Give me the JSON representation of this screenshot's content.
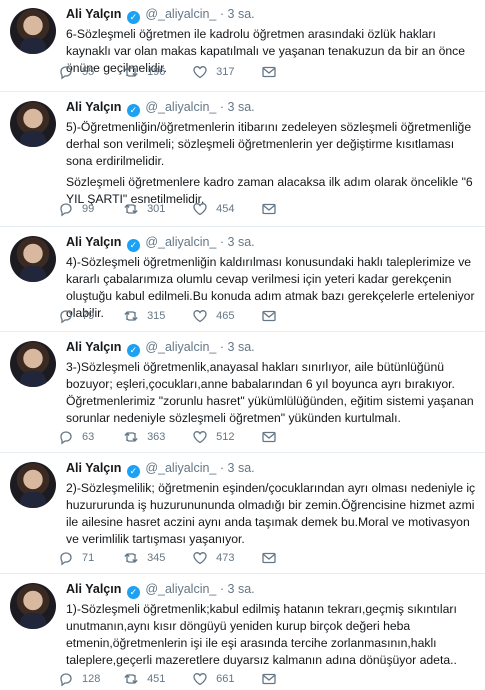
{
  "tweets": [
    {
      "name": "Ali Yalçın",
      "handle": "@_aliyalcin_",
      "dot": "·",
      "time": "3 sa.",
      "paragraphs": [
        "6-Sözleşmeli öğretmen ile kadrolu öğretmen arasındaki özlük hakları kaynaklı var olan makas kapatılmalı ve yaşanan tenakuzun da bir an önce önüne geçilmelidir."
      ],
      "replies": "55",
      "retweets": "196",
      "likes": "317"
    },
    {
      "name": "Ali Yalçın",
      "handle": "@_aliyalcin_",
      "dot": "·",
      "time": "3 sa.",
      "paragraphs": [
        "5)-Öğretmenliğin/öğretmenlerin itibarını zedeleyen sözleşmeli öğretmenliğe derhal son verilmeli; sözleşmeli öğretmenlerin yer değiştirme kısıtlaması sona erdirilmelidir.",
        "Sözleşmeli öğretmenlere kadro zaman alacaksa ilk adım olarak öncelikle \"6 YIL ŞARTI\" esnetilmelidir."
      ],
      "replies": "99",
      "retweets": "301",
      "likes": "454"
    },
    {
      "name": "Ali Yalçın",
      "handle": "@_aliyalcin_",
      "dot": "·",
      "time": "3 sa.",
      "paragraphs": [
        "4)-Sözleşmeli öğretmenliğin kaldırılması konusundaki haklı taleplerimize ve kararlı çabalarımıza olumlu cevap verilmesi için yeteri kadar gerekçenin oluştuğu kabul edilmeli.Bu konuda adım atmak bazı gerekçelerle erteleniyor olabilir."
      ],
      "replies": "79",
      "retweets": "315",
      "likes": "465"
    },
    {
      "name": "Ali Yalçın",
      "handle": "@_aliyalcin_",
      "dot": "·",
      "time": "3 sa.",
      "paragraphs": [
        "3-)Sözleşmeli öğretmenlik,anayasal hakları sınırlıyor, aile bütünlüğünü bozuyor; eşleri,çocukları,anne babalarından 6 yıl boyunca ayrı bırakıyor. Öğretmenlerimiz \"zorunlu hasret\" yükümlülüğünden, eğitim sistemi yaşanan sorunlar nedeniyle sözleşmeli öğretmen\" yükünden kurtulmalı."
      ],
      "replies": "63",
      "retweets": "363",
      "likes": "512"
    },
    {
      "name": "Ali Yalçın",
      "handle": "@_aliyalcin_",
      "dot": "·",
      "time": "3 sa.",
      "paragraphs": [
        "2)-Sözleşmelilik; öğretmenin eşinden/çocuklarından ayrı olması nedeniyle iç huzururunda iş huzurunununda olmadığı bir zemin.Öğrencisine hizmet azmi ile ailesine hasret aczini aynı anda taşımak demek bu.Moral ve motivasyon ve verimlilik tartışması yaşanıyor."
      ],
      "replies": "71",
      "retweets": "345",
      "likes": "473"
    },
    {
      "name": "Ali Yalçın",
      "handle": "@_aliyalcin_",
      "dot": "·",
      "time": "3 sa.",
      "paragraphs": [
        "1)-Sözleşmeli öğretmenlik;kabul edilmiş hatanın tekrarı,geçmiş sıkıntıları unutmanın,aynı kısır döngüyü yeniden kurup birçok değeri heba etmenin,öğretmenlerin işi ile eşi arasında tercihe zorlanmasının,haklı taleplere,geçerli mazeretlere duyarsız kalmanın adına dönüşüyor adeta.."
      ],
      "replies": "128",
      "retweets": "451",
      "likes": "661"
    }
  ],
  "icons": {
    "reply": "reply-icon",
    "retweet": "retweet-icon",
    "like": "heart-icon",
    "message": "envelope-icon",
    "verified": "verified-badge-icon"
  },
  "colors": {
    "verified": "#1da1f2",
    "muted": "#657786",
    "text": "#14171a"
  }
}
